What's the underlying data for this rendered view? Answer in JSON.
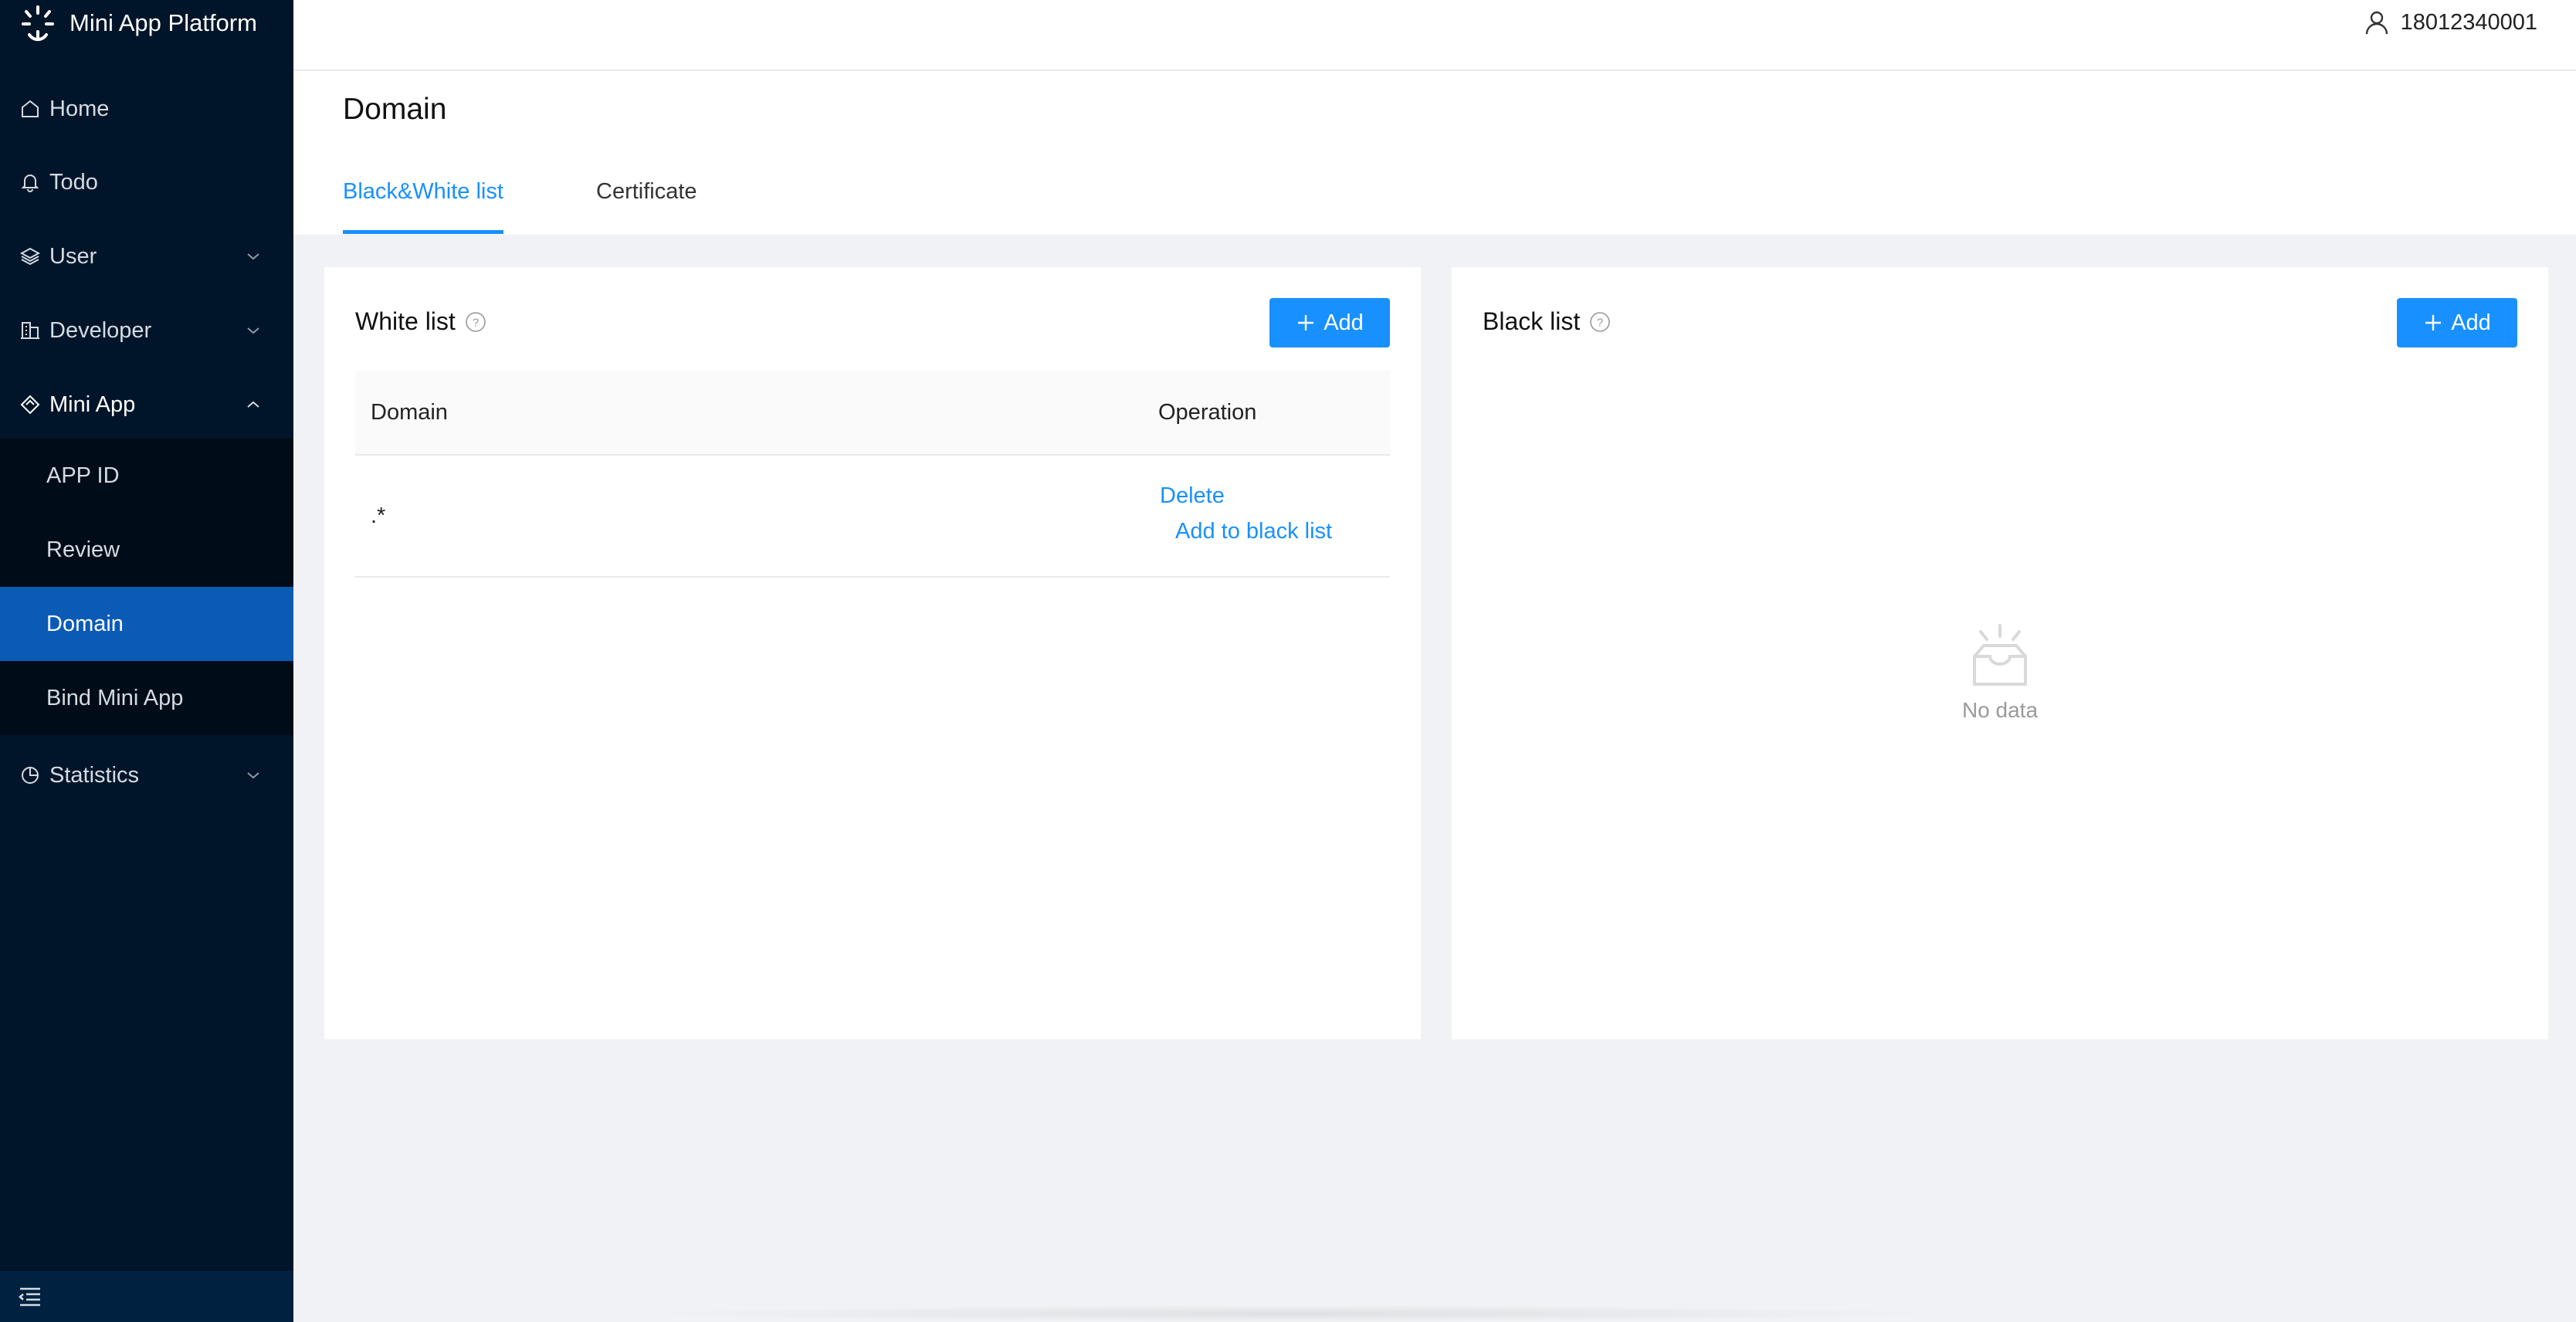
{
  "app": {
    "title": "Mini App Platform"
  },
  "user": {
    "name": "18012340001"
  },
  "sidebar": {
    "items": [
      {
        "label": "Home",
        "icon": "home-icon"
      },
      {
        "label": "Todo",
        "icon": "bell-icon"
      },
      {
        "label": "User",
        "icon": "layers-icon"
      },
      {
        "label": "Developer",
        "icon": "building-icon"
      },
      {
        "label": "Mini App",
        "icon": "diamond-icon"
      },
      {
        "label": "Statistics",
        "icon": "pie-chart-icon"
      }
    ],
    "mini_app_sub": [
      {
        "label": "APP ID"
      },
      {
        "label": "Review"
      },
      {
        "label": "Domain",
        "active": true
      },
      {
        "label": "Bind Mini App"
      }
    ]
  },
  "page": {
    "title": "Domain",
    "tabs": [
      {
        "label": "Black&White list",
        "active": true
      },
      {
        "label": "Certificate"
      }
    ]
  },
  "white_list": {
    "title": "White list",
    "add_label": "Add",
    "columns": [
      "Domain",
      "Operation"
    ],
    "rows": [
      {
        "domain": ".*",
        "delete_label": "Delete",
        "move_label": "Add to black list"
      }
    ]
  },
  "black_list": {
    "title": "Black list",
    "add_label": "Add",
    "empty_text": "No data"
  },
  "colors": {
    "sidebar": "#001529",
    "active": "#0b5bb5",
    "primary": "#1890ff"
  }
}
